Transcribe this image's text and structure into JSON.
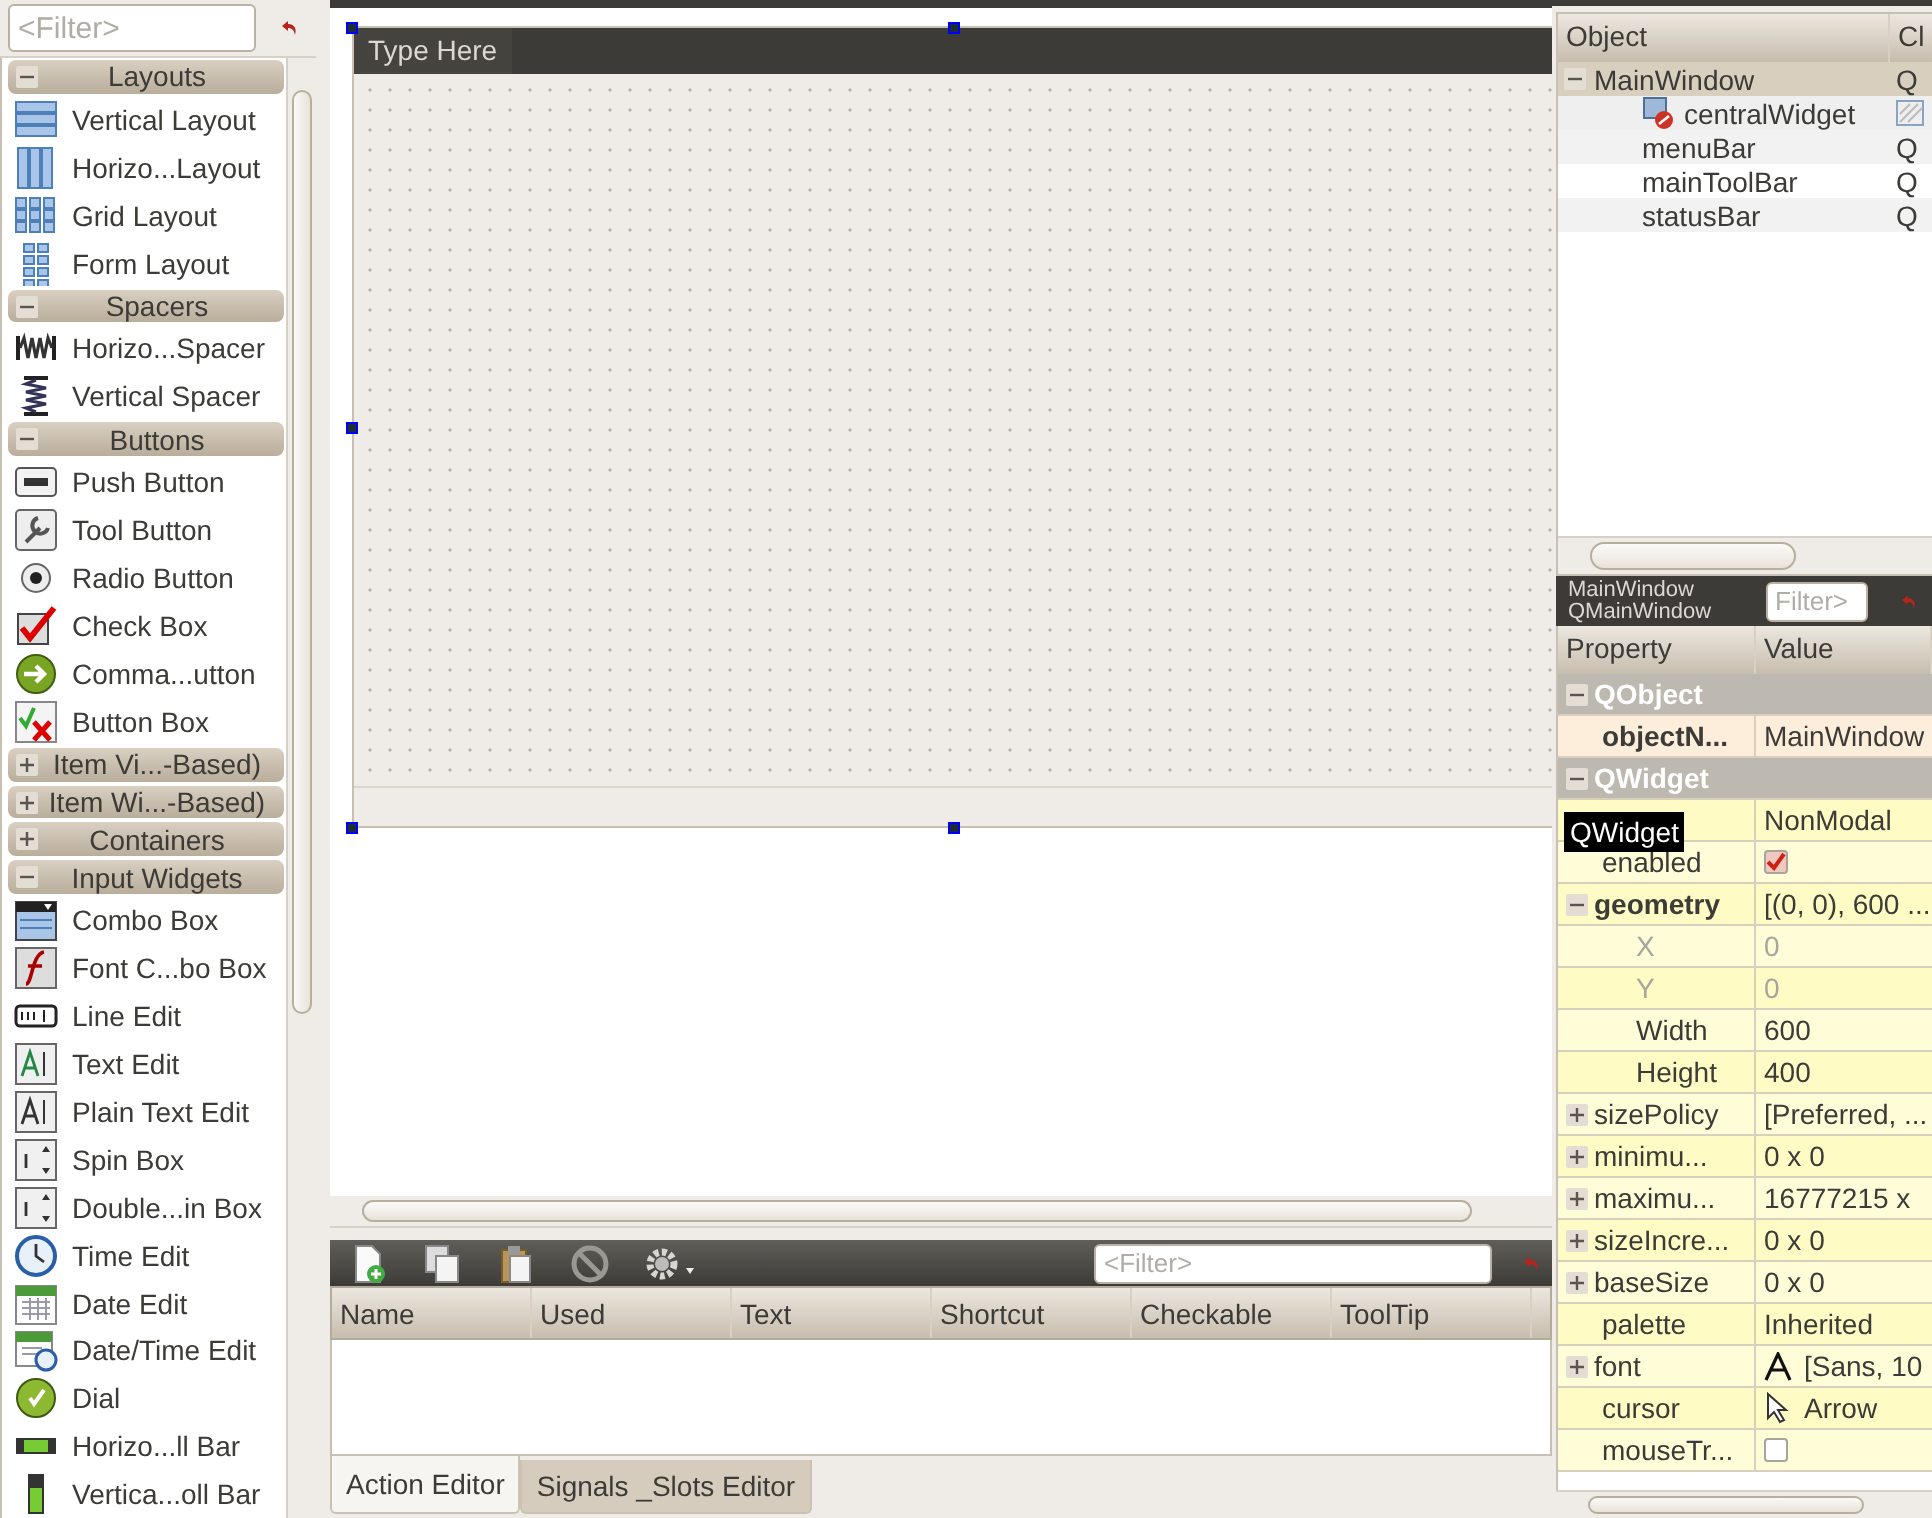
{
  "widget_box": {
    "filter": {
      "placeholder": "<Filter>"
    },
    "sections": [
      {
        "name": "Layouts",
        "expanded": true,
        "items": [
          {
            "name": "Vertical Layout",
            "kind": "vlayout"
          },
          {
            "name": "Horizo...Layout",
            "kind": "hlayout"
          },
          {
            "name": "Grid Layout",
            "kind": "grid"
          },
          {
            "name": "Form Layout",
            "kind": "form"
          }
        ]
      },
      {
        "name": "Spacers",
        "expanded": true,
        "items": [
          {
            "name": "Horizo...Spacer",
            "kind": "hspacer"
          },
          {
            "name": "Vertical Spacer",
            "kind": "vspacer"
          }
        ]
      },
      {
        "name": "Buttons",
        "expanded": true,
        "items": [
          {
            "name": "Push Button",
            "kind": "push"
          },
          {
            "name": "Tool Button",
            "kind": "tool"
          },
          {
            "name": "Radio Button",
            "kind": "radio"
          },
          {
            "name": "Check Box",
            "kind": "check"
          },
          {
            "name": "Comma...utton",
            "kind": "command"
          },
          {
            "name": "Button Box",
            "kind": "buttonbox"
          }
        ]
      },
      {
        "name": "Item Vi...-Based)",
        "expanded": false
      },
      {
        "name": "Item Wi...-Based)",
        "expanded": false
      },
      {
        "name": "Containers",
        "expanded": false
      },
      {
        "name": "Input Widgets",
        "expanded": true,
        "items": [
          {
            "name": "Combo Box",
            "kind": "combo"
          },
          {
            "name": "Font C...bo Box",
            "kind": "fontcombo"
          },
          {
            "name": "Line Edit",
            "kind": "lineedit"
          },
          {
            "name": "Text Edit",
            "kind": "textedit"
          },
          {
            "name": "Plain Text Edit",
            "kind": "plaintext"
          },
          {
            "name": "Spin Box",
            "kind": "spin"
          },
          {
            "name": "Double...in Box",
            "kind": "dspin"
          },
          {
            "name": "Time Edit",
            "kind": "time"
          },
          {
            "name": "Date Edit",
            "kind": "date"
          },
          {
            "name": "Date/Time Edit",
            "kind": "datetime"
          },
          {
            "name": "Dial",
            "kind": "dial"
          },
          {
            "name": "Horizo...ll Bar",
            "kind": "hscroll"
          },
          {
            "name": "Vertica...oll Bar",
            "kind": "vscroll"
          }
        ]
      }
    ]
  },
  "form": {
    "menu_placeholder": "Type Here"
  },
  "action_editor": {
    "filter": {
      "placeholder": "<Filter>"
    },
    "columns": [
      "Name",
      "Used",
      "Text",
      "Shortcut",
      "Checkable",
      "ToolTip"
    ],
    "tabs": [
      {
        "label": "Action Editor",
        "selected": true
      },
      {
        "label": "Signals _Slots Editor",
        "selected": false
      }
    ]
  },
  "object_inspector": {
    "columns": [
      "Object",
      "Cl"
    ],
    "tree": [
      {
        "name": "MainWindow",
        "class": "Q",
        "expanded": true,
        "children": [
          {
            "name": "centralWidget",
            "kind": "hatched",
            "selected": true
          },
          {
            "name": "menuBar",
            "class": "Q",
            "kind": "text",
            "selected": false
          },
          {
            "name": "mainToolBar",
            "class": "Q",
            "kind": "text",
            "selected": false
          },
          {
            "name": "statusBar",
            "class": "Q",
            "kind": "text",
            "selected": false
          }
        ]
      }
    ]
  },
  "property_editor": {
    "object_name": "MainWindow",
    "class_name": "QMainWindow",
    "filter": {
      "placeholder": "Filter>"
    },
    "columns": [
      "Property",
      "Value"
    ],
    "rows": [
      {
        "kind": "group",
        "name": "QObject"
      },
      {
        "kind": "text",
        "name": "objectN...",
        "value": "MainWindow",
        "bold": true
      },
      {
        "kind": "group",
        "name": "QWidget"
      },
      {
        "kind": "text",
        "value": "NonModal"
      },
      {
        "kind": "check",
        "name": "enabled",
        "checked": true,
        "bold": false
      },
      {
        "kind": "text",
        "name": "geometry",
        "value": "[(0, 0), 600 ...",
        "bold": true,
        "expanded": true,
        "children": [
          {
            "kind": "text",
            "name": "X",
            "value": "0",
            "disabled": true
          },
          {
            "kind": "text",
            "name": "Y",
            "value": "0",
            "disabled": true
          },
          {
            "kind": "text",
            "name": "Width",
            "value": "600",
            "disabled": false
          },
          {
            "kind": "text",
            "name": "Height",
            "value": "400",
            "disabled": false
          }
        ]
      },
      {
        "kind": "text",
        "name": "sizePolicy",
        "value": "[Preferred, ...",
        "expanded": false,
        "bold": false
      },
      {
        "kind": "text",
        "name": "minimu...",
        "value": "0 x 0",
        "expanded": false,
        "bold": false
      },
      {
        "kind": "text",
        "name": "maximu...",
        "value": "16777215 x",
        "expanded": false,
        "bold": false
      },
      {
        "kind": "text",
        "name": "sizeIncre...",
        "value": "0 x 0",
        "expanded": false,
        "bold": false
      },
      {
        "kind": "text",
        "name": "baseSize",
        "value": "0 x 0",
        "expanded": false,
        "bold": false
      },
      {
        "kind": "text",
        "name": "palette",
        "value": "Inherited",
        "bold": false
      },
      {
        "kind": "font",
        "name": "font",
        "value": "[Sans, 10",
        "expanded": false,
        "bold": false
      },
      {
        "kind": "cursor",
        "name": "cursor",
        "value": "Arrow",
        "bold": false
      },
      {
        "kind": "check",
        "name": "mouseTr...",
        "checked": false,
        "bold": false
      }
    ],
    "tooltip": "QWidget"
  }
}
